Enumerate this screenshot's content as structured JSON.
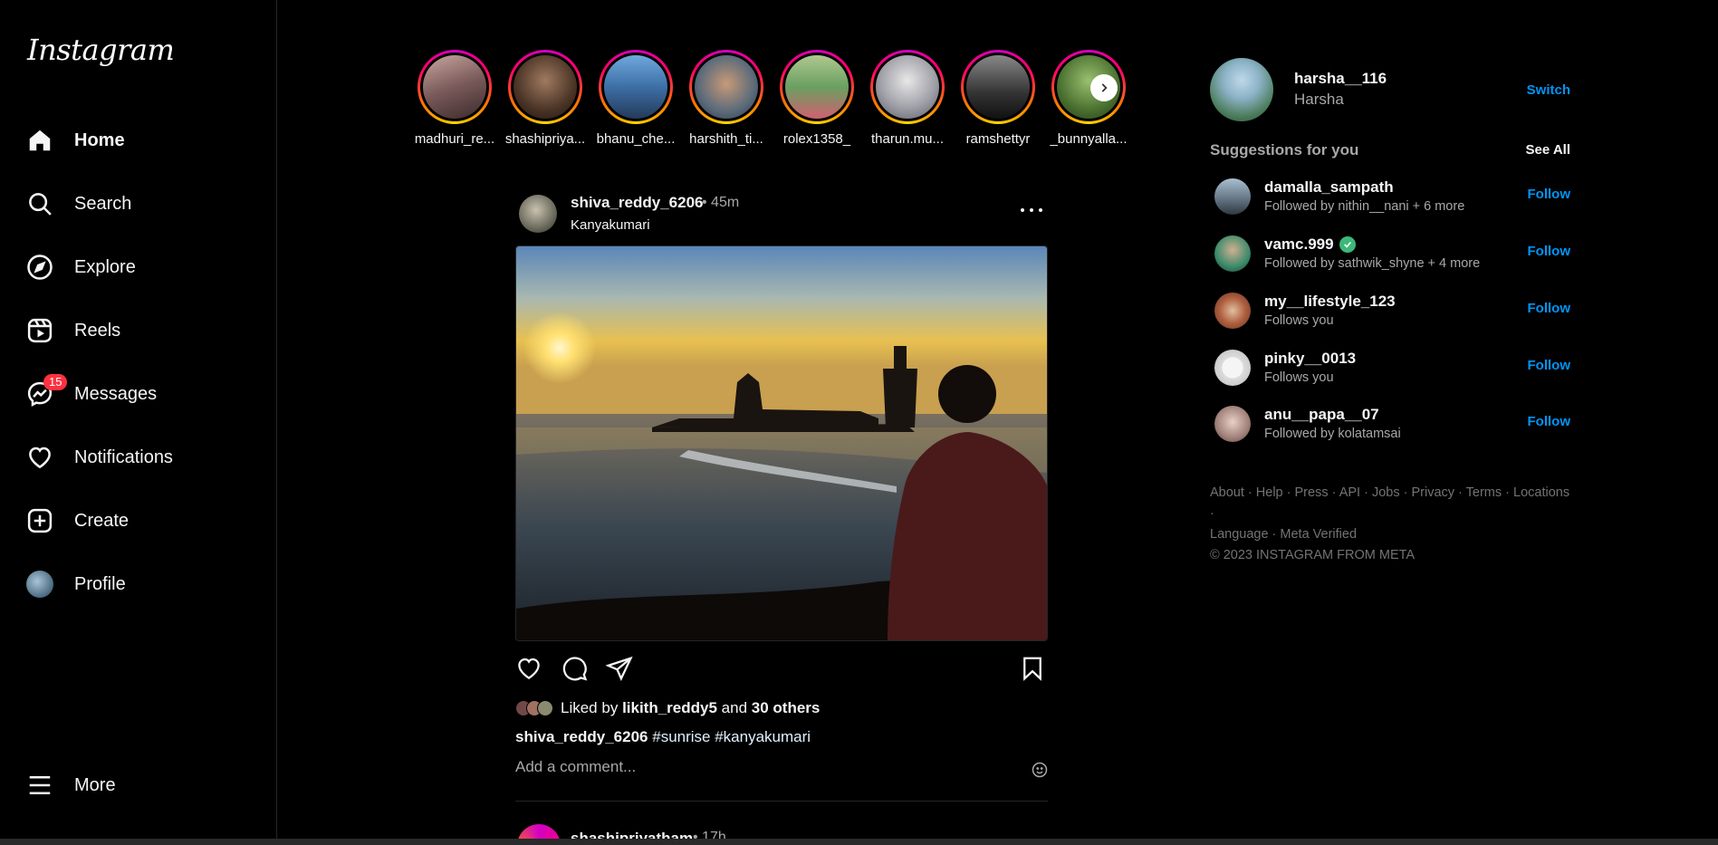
{
  "app": {
    "logo": "Instagram"
  },
  "nav": {
    "items": [
      {
        "label": "Home",
        "icon": "home-icon",
        "active": true
      },
      {
        "label": "Search",
        "icon": "search-icon"
      },
      {
        "label": "Explore",
        "icon": "compass-icon"
      },
      {
        "label": "Reels",
        "icon": "reels-icon"
      },
      {
        "label": "Messages",
        "icon": "messenger-icon",
        "badge": "15"
      },
      {
        "label": "Notifications",
        "icon": "heart-icon"
      },
      {
        "label": "Create",
        "icon": "plus-square-icon"
      },
      {
        "label": "Profile",
        "icon": "avatar"
      }
    ],
    "more": "More"
  },
  "stories": [
    {
      "user": "madhuri_re..."
    },
    {
      "user": "shashipriya..."
    },
    {
      "user": "bhanu_che..."
    },
    {
      "user": "harshith_ti..."
    },
    {
      "user": "rolex1358_"
    },
    {
      "user": "tharun.mu..."
    },
    {
      "user": "ramshettyr"
    },
    {
      "user": "_bunnyalla..."
    }
  ],
  "post": {
    "user": "shiva_reddy_6206",
    "time": "• 45m",
    "location": "Kanyakumari",
    "liked_prefix": "Liked by",
    "liked_user": "likith_reddy5",
    "liked_and": "and",
    "liked_others": "30 others",
    "caption_user": "shiva_reddy_6206",
    "caption_tags": "#sunrise #kanyakumari",
    "comment_placeholder": "Add a comment..."
  },
  "next_post": {
    "user": "shashipriyatham",
    "time": "• 17h"
  },
  "me": {
    "username": "harsha__116",
    "name": "Harsha",
    "switch": "Switch"
  },
  "suggestions": {
    "title": "Suggestions for you",
    "see_all": "See All",
    "follow_label": "Follow",
    "items": [
      {
        "user": "damalla_sampath",
        "sub": "Followed by nithin__nani + 6 more"
      },
      {
        "user": "vamc.999",
        "sub": "Followed by sathwik_shyne + 4 more",
        "verified": true
      },
      {
        "user": "my__lifestyle_123",
        "sub": "Follows you"
      },
      {
        "user": "pinky__0013",
        "sub": "Follows you"
      },
      {
        "user": "anu__papa__07",
        "sub": "Followed by kolatamsai"
      }
    ]
  },
  "footer": {
    "links": [
      "About",
      "Help",
      "Press",
      "API",
      "Jobs",
      "Privacy",
      "Terms",
      "Locations",
      "Language",
      "Meta Verified"
    ],
    "copyright": "© 2023 INSTAGRAM FROM META"
  },
  "colors": {
    "accent": "#0095f6",
    "badge": "#ff3040",
    "background": "#000000",
    "muted": "#a8a8a8"
  }
}
